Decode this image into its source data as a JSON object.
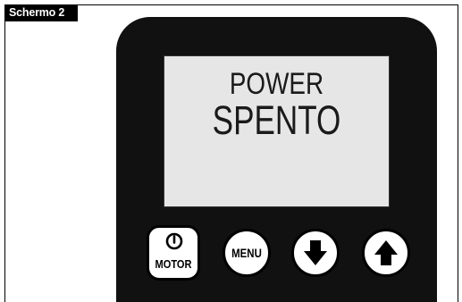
{
  "screen_tag": "Schermo 2",
  "display": {
    "line1": "POWER",
    "line2": "SPENTO"
  },
  "buttons": {
    "motor_label": "MOTOR",
    "menu_label": "MENU",
    "down_icon": "arrow-down-icon",
    "up_icon": "arrow-up-icon",
    "power_icon": "power-icon"
  },
  "colors": {
    "device_body": "#111111",
    "lcd_background": "#e6e6e6",
    "button_face": "#ffffff"
  }
}
